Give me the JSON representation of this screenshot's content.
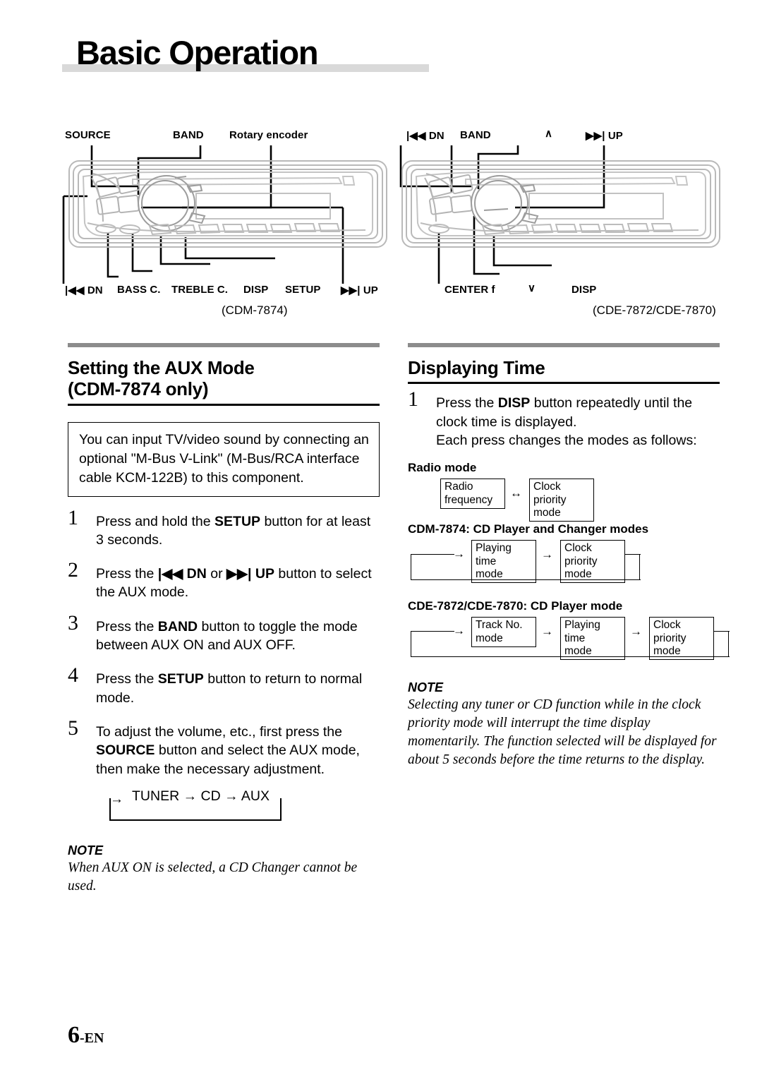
{
  "page": {
    "title": "Basic Operation",
    "footer_page": "6",
    "footer_lang": "-EN"
  },
  "diagram": {
    "left_unit": {
      "model_caption": "(CDM-7874)",
      "top_labels": [
        {
          "text": "SOURCE"
        },
        {
          "text": "BAND"
        },
        {
          "text": "Rotary encoder"
        }
      ],
      "bottom_labels": [
        {
          "text": "|◀◀ DN"
        },
        {
          "text": "BASS C."
        },
        {
          "text": "TREBLE C."
        },
        {
          "text": "DISP"
        },
        {
          "text": "SETUP"
        },
        {
          "text": "▶▶| UP"
        }
      ]
    },
    "right_unit": {
      "model_caption": "(CDE-7872/CDE-7870)",
      "top_labels": [
        {
          "text": "|◀◀ DN"
        },
        {
          "text": "BAND"
        },
        {
          "text": "∧"
        },
        {
          "text": "▶▶| UP"
        }
      ],
      "bottom_labels": [
        {
          "text": "CENTER f"
        },
        {
          "text": "∨"
        },
        {
          "text": "DISP"
        }
      ]
    }
  },
  "left_column": {
    "heading_line1": "Setting the AUX Mode",
    "heading_line2": "(CDM-7874 only)",
    "info_box": "You can input TV/video sound by connecting an optional \"M-Bus V-Link\" (M-Bus/RCA interface cable KCM-122B) to this component.",
    "steps": [
      {
        "num": "1",
        "parts": [
          {
            "t": "Press and hold the ",
            "b": false
          },
          {
            "t": "SETUP",
            "b": true
          },
          {
            "t": " button for at least 3 seconds.",
            "b": false
          }
        ]
      },
      {
        "num": "2",
        "parts": [
          {
            "t": "Press the ",
            "b": false
          },
          {
            "t": "|◀◀ DN",
            "b": true
          },
          {
            "t": " or ",
            "b": false
          },
          {
            "t": "▶▶| UP",
            "b": true
          },
          {
            "t": " button to select the AUX mode.",
            "b": false
          }
        ]
      },
      {
        "num": "3",
        "parts": [
          {
            "t": "Press the ",
            "b": false
          },
          {
            "t": "BAND",
            "b": true
          },
          {
            "t": " button to toggle the mode between AUX ON and AUX OFF.",
            "b": false
          }
        ]
      },
      {
        "num": "4",
        "parts": [
          {
            "t": "Press the ",
            "b": false
          },
          {
            "t": "SETUP",
            "b": true
          },
          {
            "t": " button to return to normal mode.",
            "b": false
          }
        ]
      },
      {
        "num": "5",
        "parts": [
          {
            "t": "To adjust the volume, etc., first press the ",
            "b": false
          },
          {
            "t": "SOURCE",
            "b": true
          },
          {
            "t": " button and select the AUX mode, then make the necessary adjustment.",
            "b": false
          }
        ]
      }
    ],
    "source_loop": "TUNER → CD → AUX",
    "note": {
      "title": "NOTE",
      "body": "When AUX ON is selected, a CD Changer cannot be used."
    }
  },
  "right_column": {
    "heading": "Displaying Time",
    "steps": [
      {
        "num": "1",
        "parts": [
          {
            "t": "Press the ",
            "b": false
          },
          {
            "t": "DISP",
            "b": true
          },
          {
            "t": " button repeatedly until the clock time is displayed.",
            "b": false
          }
        ],
        "extra_line": "Each press changes the modes as follows:"
      }
    ],
    "flows": [
      {
        "label": "Radio mode",
        "boxes": [
          "Radio frequency",
          "Clock priority\nmode"
        ],
        "connector": "↔",
        "loop": false
      },
      {
        "label": "CDM-7874: CD Player and Changer modes",
        "boxes": [
          "Playing time\nmode",
          "Clock priority\nmode"
        ],
        "connector": "→",
        "loop": true
      },
      {
        "label": "CDE-7872/CDE-7870: CD Player mode",
        "boxes": [
          "Track No.\nmode",
          "Playing time\nmode",
          "Clock priority\nmode"
        ],
        "connector": "→",
        "loop": true
      }
    ],
    "note": {
      "title": "NOTE",
      "body": "Selecting any tuner or CD function while in the clock priority mode will interrupt the time display momentarily. The function selected will be displayed for about 5 seconds before the time returns to the display."
    }
  }
}
